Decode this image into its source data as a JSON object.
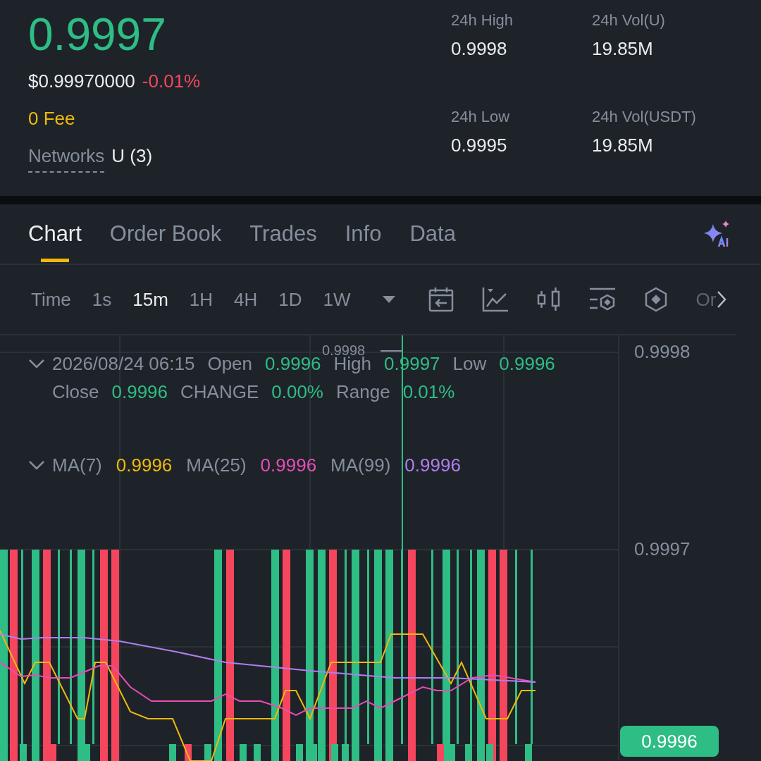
{
  "ticker": {
    "price": "0.9997",
    "usd_price": "$0.99970000",
    "change": "-0.01%",
    "fee": "0 Fee",
    "networks_label": "Networks",
    "networks_value": "U (3)"
  },
  "stats": [
    {
      "label": "24h High",
      "value": "0.9998"
    },
    {
      "label": "24h Vol(U)",
      "value": "19.85M"
    },
    {
      "label": "24h Low",
      "value": "0.9995"
    },
    {
      "label": "24h Vol(USDT)",
      "value": "19.85M"
    }
  ],
  "tabs": [
    {
      "label": "Chart",
      "selected": true
    },
    {
      "label": "Order Book",
      "selected": false
    },
    {
      "label": "Trades",
      "selected": false
    },
    {
      "label": "Info",
      "selected": false
    },
    {
      "label": "Data",
      "selected": false
    }
  ],
  "intervals": [
    {
      "label": "Time",
      "selected": false
    },
    {
      "label": "1s",
      "selected": false
    },
    {
      "label": "15m",
      "selected": true
    },
    {
      "label": "1H",
      "selected": false
    },
    {
      "label": "4H",
      "selected": false
    },
    {
      "label": "1D",
      "selected": false
    },
    {
      "label": "1W",
      "selected": false
    }
  ],
  "toolbar_overflow": "Or",
  "chart": {
    "crosshair_price": "0.9998",
    "datetime": "2026/08/24 06:15",
    "ohlc": [
      {
        "label": "Open",
        "value": "0.9996"
      },
      {
        "label": "High",
        "value": "0.9997"
      },
      {
        "label": "Low",
        "value": "0.9996"
      },
      {
        "label": "Close",
        "value": "0.9996"
      },
      {
        "label": "CHANGE",
        "value": "0.00%"
      },
      {
        "label": "Range",
        "value": "0.01%"
      }
    ],
    "ma": [
      {
        "label": "MA(7)",
        "value": "0.9996",
        "color": "#f0b90b"
      },
      {
        "label": "MA(25)",
        "value": "0.9996",
        "color": "#e84cb5"
      },
      {
        "label": "MA(99)",
        "value": "0.9996",
        "color": "#b07ef0"
      }
    ],
    "axis_labels": [
      "0.9998",
      "0.9997"
    ],
    "last_price": "0.9996"
  }
}
